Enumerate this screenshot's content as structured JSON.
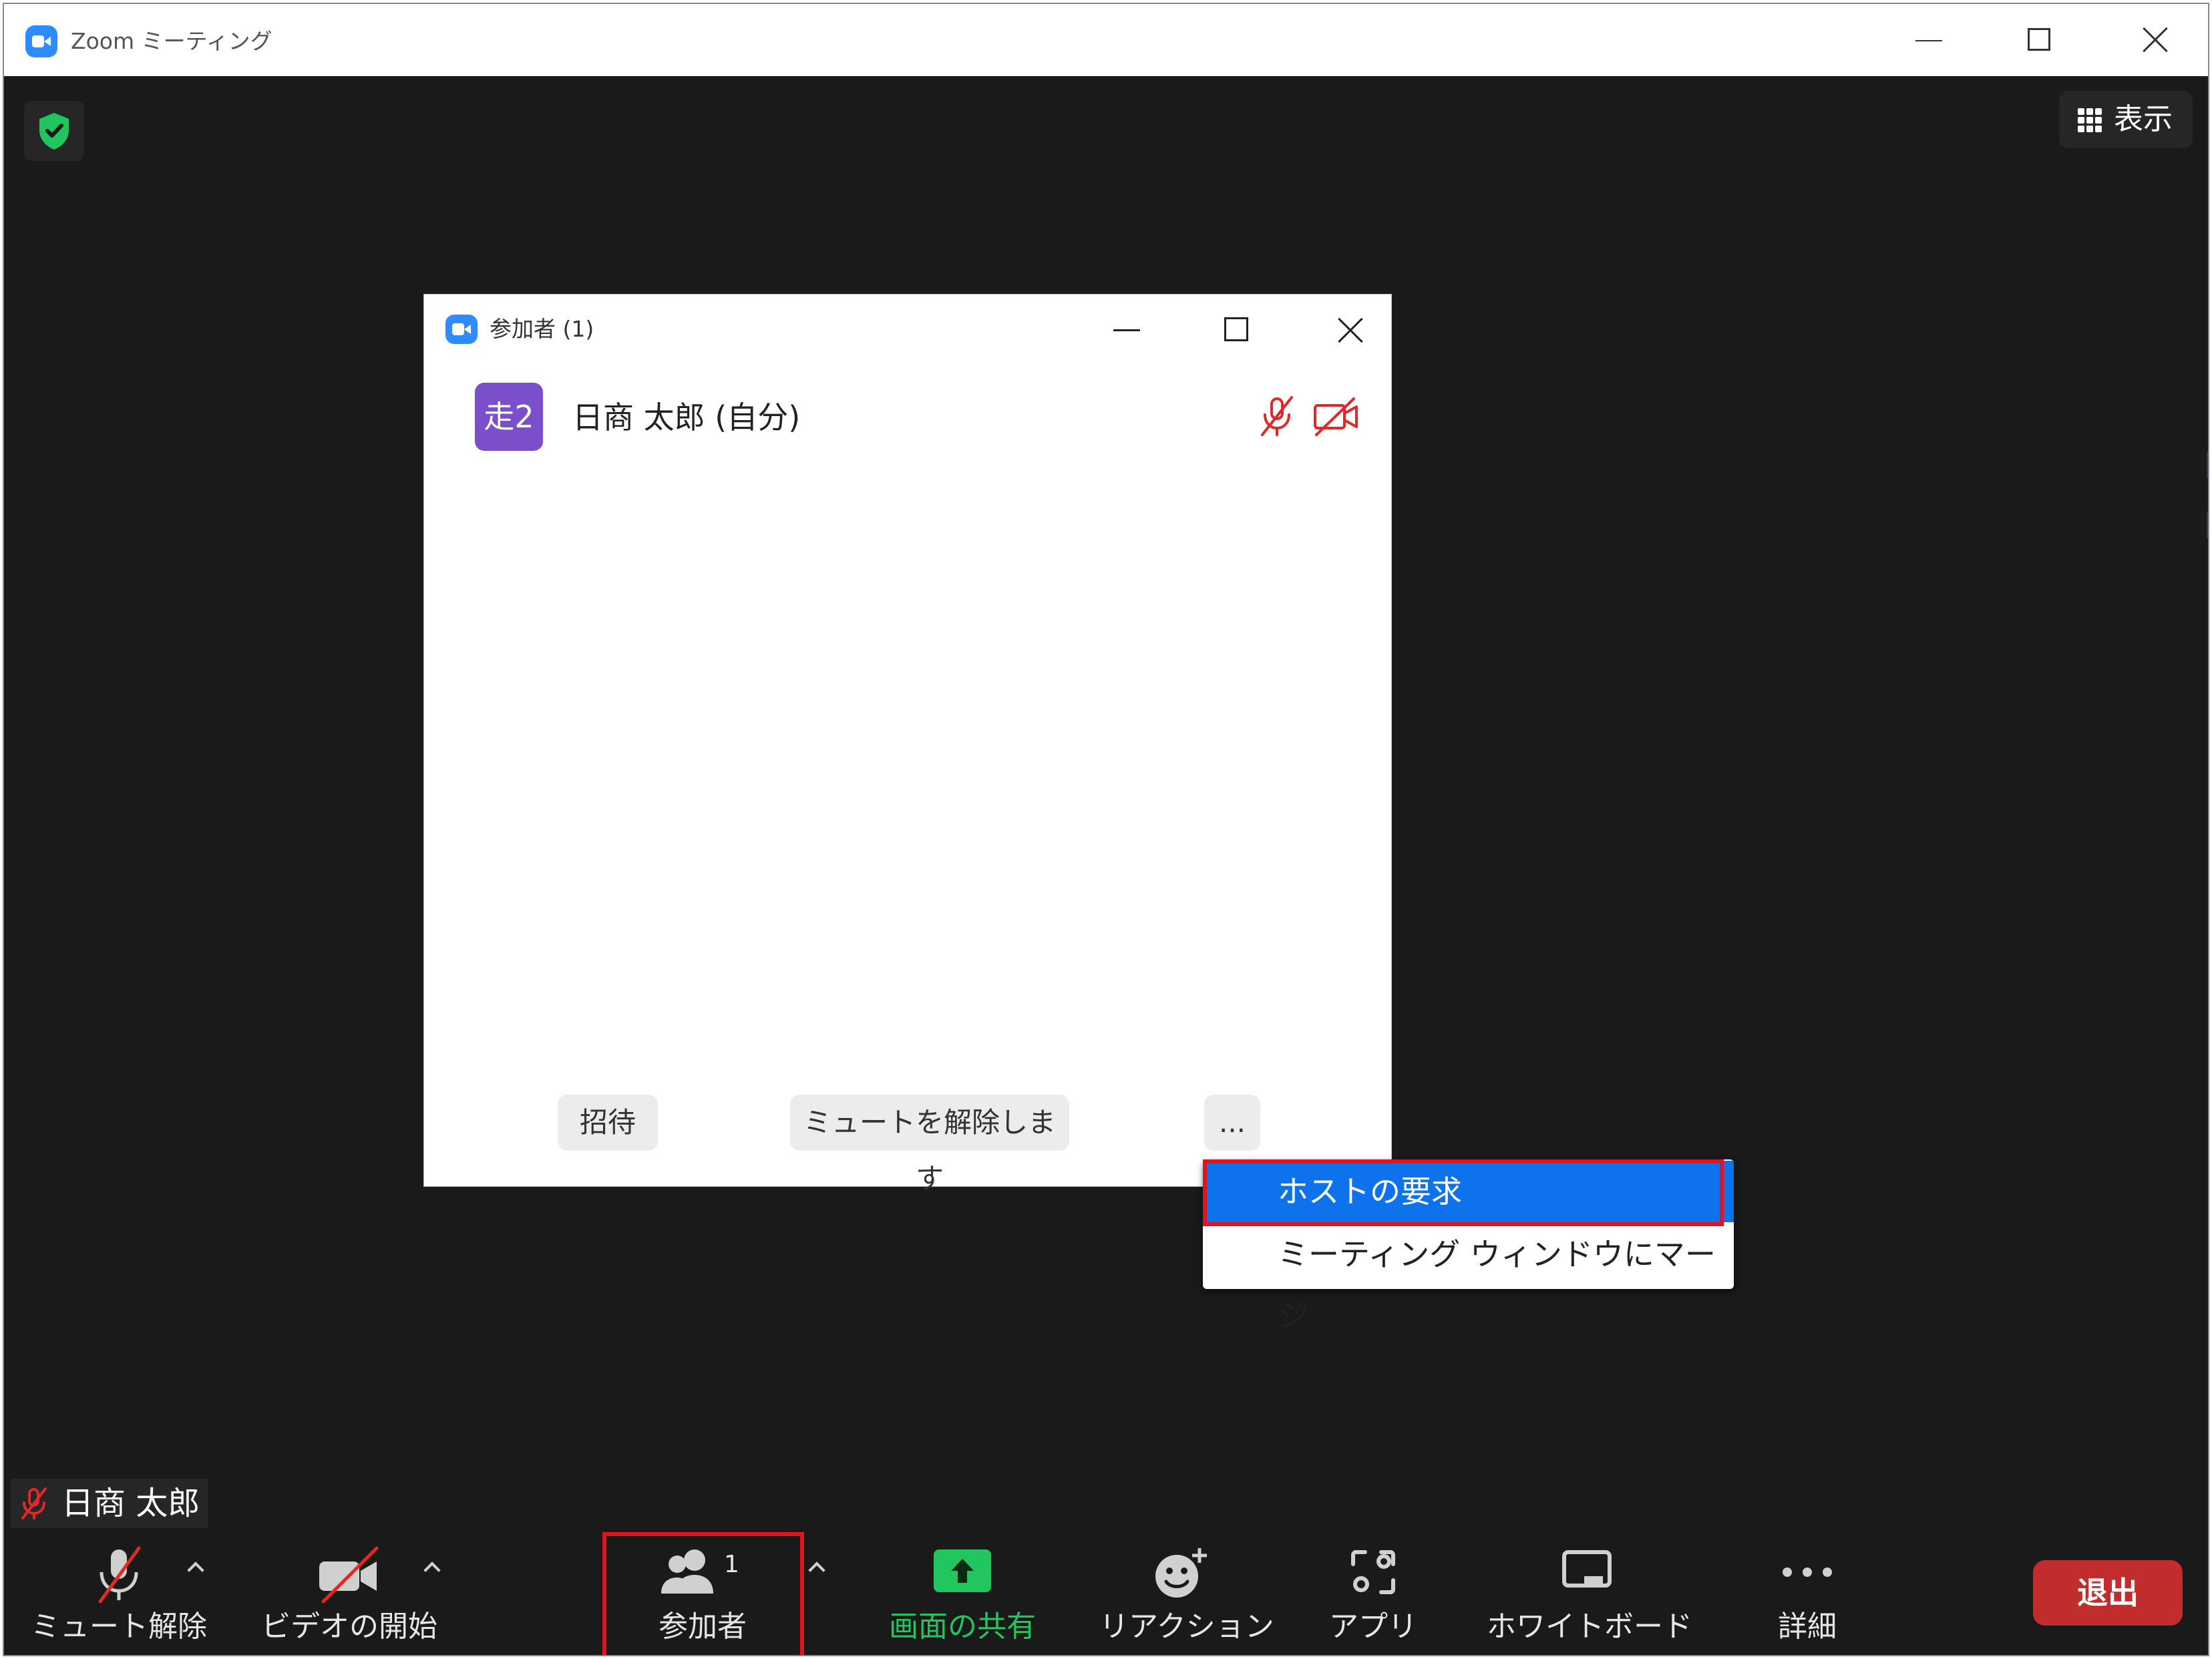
{
  "window": {
    "title": "Zoom ミーティング",
    "icons": {
      "logo": "zoom-logo-icon",
      "minimize": "minimize-icon",
      "maximize": "maximize-icon",
      "close": "close-icon"
    }
  },
  "meeting": {
    "security_icon": "shield-check-icon",
    "view_button_label": "表示"
  },
  "participants_panel": {
    "title": "参加者 (1)",
    "participants": [
      {
        "avatar_text": "走2",
        "avatar_color": "#7b4fc9",
        "name": "日商 太郎 (自分)",
        "muted": true,
        "video_off": true
      }
    ],
    "buttons": {
      "invite": "招待",
      "unmute": "ミュートを解除します",
      "more": "..."
    }
  },
  "more_menu": {
    "items": [
      {
        "label": "ホストの要求",
        "highlighted": true
      },
      {
        "label": "ミーティング ウィンドウにマージ",
        "highlighted": false
      }
    ]
  },
  "self_tile": {
    "name": "日商 太郎",
    "muted": true
  },
  "toolbar": {
    "unmute": "ミュート解除",
    "start_video": "ビデオの開始",
    "participants": "参加者",
    "participants_count": "1",
    "share_screen": "画面の共有",
    "reactions": "リアクション",
    "apps": "アプリ",
    "whiteboard": "ホワイトボード",
    "more": "詳細",
    "leave": "退出"
  },
  "colors": {
    "accent": "#2d8cff",
    "share_green": "#22c55e",
    "leave_red": "#c12d2d",
    "highlight_red": "#e0141e",
    "menu_active": "#0e72ed",
    "muted_red": "#e02828"
  }
}
